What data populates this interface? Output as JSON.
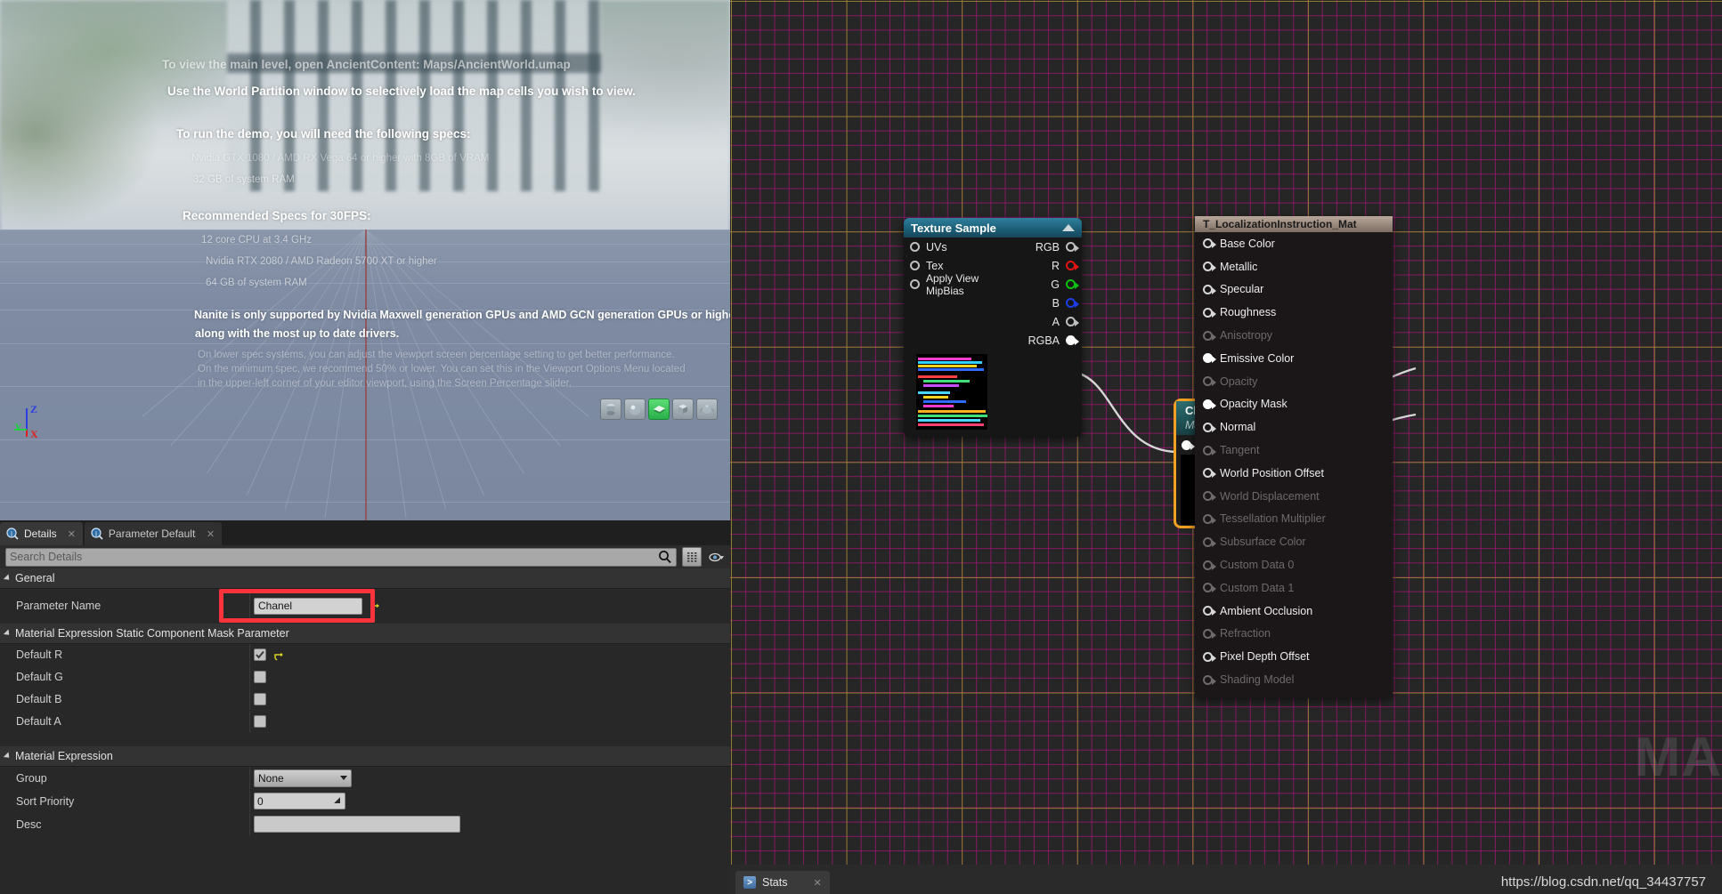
{
  "viewport": {
    "lines": [
      {
        "text": "To view the main level, open AncientContent: Maps/AncientWorld.umap",
        "style": "a",
        "fade": "fade"
      },
      {
        "text": "Use the World Partition window to selectively load the map cells you wish to view.",
        "style": "a",
        "fade": "none"
      },
      {
        "text": "To run the demo, you will need the following specs:",
        "style": "a",
        "fade": "none"
      },
      {
        "text": "Nvidia GTX 1080 / AMD RX Vega 64 or higher with 8GB of VRAM",
        "style": "sm",
        "fade": "fade2"
      },
      {
        "text": "32 GB of system RAM",
        "style": "sm",
        "fade": "fade"
      },
      {
        "text": "Recommended Specs for 30FPS:",
        "style": "a",
        "fade": "none"
      },
      {
        "text": "12 core CPU at 3.4 GHz",
        "style": "sm",
        "fade": "fade"
      },
      {
        "text": "Nvidia RTX 2080 / AMD Radeon 5700 XT or higher",
        "style": "sm",
        "fade": "fade"
      },
      {
        "text": "64 GB of system RAM",
        "style": "sm",
        "fade": "fade"
      },
      {
        "text": "Nanite is only supported by Nvidia Maxwell generation GPUs and AMD GCN generation GPUs or higher,",
        "style": "b",
        "fade": "none"
      },
      {
        "text": "along with the most up to date drivers.",
        "style": "b",
        "fade": "none"
      },
      {
        "text": "On lower spec systems, you can adjust the viewport screen percentage setting to get better performance.",
        "style": "sm",
        "fade": "fade2"
      },
      {
        "text": "On the minimum spec, we recommend 50% or lower. You can set this in the Viewport Options Menu located",
        "style": "sm",
        "fade": "fade2"
      },
      {
        "text": "in the upper-left corner of your editor viewport, using the Screen Percentage slider.",
        "style": "sm",
        "fade": "fade2"
      }
    ],
    "gizmo": {
      "z": "Z",
      "y": "Y",
      "x": "X"
    },
    "preview_shapes": [
      {
        "name": "cylinder",
        "active": false
      },
      {
        "name": "sphere",
        "active": false
      },
      {
        "name": "plane",
        "active": true
      },
      {
        "name": "cube",
        "active": false
      },
      {
        "name": "teapot",
        "active": false
      }
    ]
  },
  "details": {
    "tabs": [
      {
        "label": "Details",
        "active": true
      },
      {
        "label": "Parameter Defaults",
        "active": false
      }
    ],
    "search_placeholder": "Search Details",
    "sections": [
      {
        "title": "General",
        "rows": [
          {
            "label": "Parameter Name",
            "kind": "text",
            "value": "Chanel",
            "reset": true,
            "highlight": true
          }
        ]
      },
      {
        "title": "Material Expression Static Component Mask Parameter",
        "rows": [
          {
            "label": "Default R",
            "kind": "checkbox",
            "checked": true,
            "reset": true
          },
          {
            "label": "Default G",
            "kind": "checkbox",
            "checked": false,
            "reset": false
          },
          {
            "label": "Default B",
            "kind": "checkbox",
            "checked": false,
            "reset": false
          },
          {
            "label": "Default A",
            "kind": "checkbox",
            "checked": false,
            "reset": false
          }
        ]
      },
      {
        "title": "Material Expression",
        "rows": [
          {
            "label": "Group",
            "kind": "dropdown",
            "value": "None"
          },
          {
            "label": "Sort Priority",
            "kind": "number",
            "value": "0"
          },
          {
            "label": "Desc",
            "kind": "desc",
            "value": ""
          }
        ]
      }
    ],
    "highlight_color": "#f8333c"
  },
  "graph": {
    "watermark": "MA",
    "nodes": {
      "texture_sample": {
        "title": "Texture Sample",
        "inputs": [
          "UVs",
          "Tex",
          "Apply View MipBias"
        ],
        "outputs": [
          {
            "label": "RGB",
            "color": "white"
          },
          {
            "label": "R",
            "color": "red"
          },
          {
            "label": "G",
            "color": "green"
          },
          {
            "label": "B",
            "color": "blue"
          },
          {
            "label": "A",
            "color": "white"
          },
          {
            "label": "RGBA",
            "color": "white",
            "connected": true
          }
        ]
      },
      "mask_param": {
        "title": "Chanel",
        "subtitle": "Mask Param",
        "selected": true,
        "accent": "#f0a023"
      },
      "material_output": {
        "title": "T_LocalizationInstruction_Mat",
        "pins": [
          {
            "label": "Base Color",
            "enabled": true,
            "connected": false
          },
          {
            "label": "Metallic",
            "enabled": true,
            "connected": false
          },
          {
            "label": "Specular",
            "enabled": true,
            "connected": false
          },
          {
            "label": "Roughness",
            "enabled": true,
            "connected": false
          },
          {
            "label": "Anisotropy",
            "enabled": false,
            "connected": false
          },
          {
            "label": "Emissive Color",
            "enabled": true,
            "connected": true
          },
          {
            "label": "Opacity",
            "enabled": false,
            "connected": false
          },
          {
            "label": "Opacity Mask",
            "enabled": true,
            "connected": true
          },
          {
            "label": "Normal",
            "enabled": true,
            "connected": false
          },
          {
            "label": "Tangent",
            "enabled": false,
            "connected": false
          },
          {
            "label": "World Position Offset",
            "enabled": true,
            "connected": false
          },
          {
            "label": "World Displacement",
            "enabled": false,
            "connected": false
          },
          {
            "label": "Tessellation Multiplier",
            "enabled": false,
            "connected": false
          },
          {
            "label": "Subsurface Color",
            "enabled": false,
            "connected": false
          },
          {
            "label": "Custom Data 0",
            "enabled": false,
            "connected": false
          },
          {
            "label": "Custom Data 1",
            "enabled": false,
            "connected": false
          },
          {
            "label": "Ambient Occlusion",
            "enabled": true,
            "connected": false
          },
          {
            "label": "Refraction",
            "enabled": false,
            "connected": false
          },
          {
            "label": "Pixel Depth Offset",
            "enabled": true,
            "connected": false
          },
          {
            "label": "Shading Model",
            "enabled": false,
            "connected": false
          }
        ]
      }
    }
  },
  "bottom": {
    "stats_tab": "Stats",
    "url": "https://blog.csdn.net/qq_34437757"
  }
}
